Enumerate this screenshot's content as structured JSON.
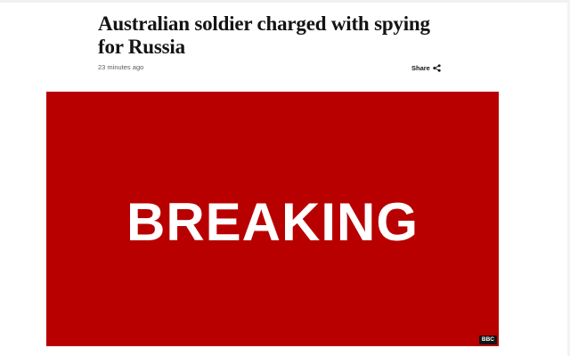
{
  "article": {
    "headline": "Australian soldier charged with spying for Russia",
    "timestamp": "23 minutes ago",
    "share_label": "Share",
    "share_icon": "share-icon"
  },
  "hero_image": {
    "word": "BREAKING",
    "credit": "BBC",
    "background_color": "#b80000",
    "text_color": "#ffffff"
  }
}
